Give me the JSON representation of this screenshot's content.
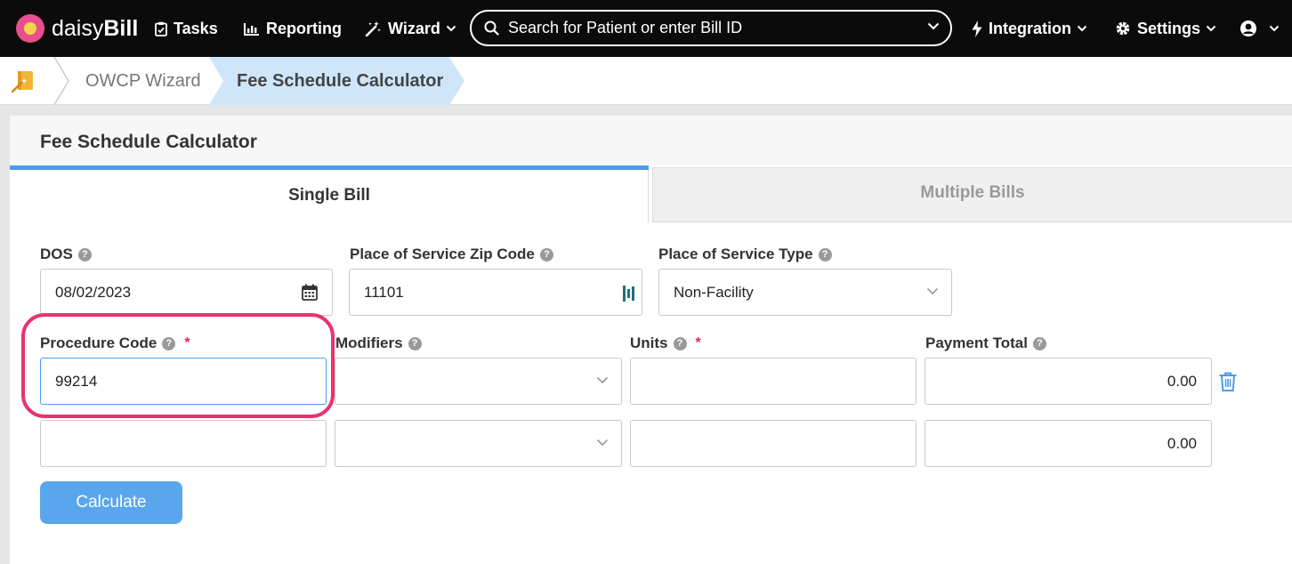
{
  "nav": {
    "brand_light": "daisy",
    "brand_bold": "Bill",
    "tasks": "Tasks",
    "reporting": "Reporting",
    "wizard": "Wizard",
    "search_placeholder": "Search for Patient or enter Bill ID",
    "integration": "Integration",
    "settings": "Settings"
  },
  "breadcrumb": {
    "items": [
      "OWCP Wizard",
      "Fee Schedule Calculator"
    ]
  },
  "panel": {
    "title": "Fee Schedule Calculator",
    "tabs": [
      {
        "label": "Single Bill",
        "active": true
      },
      {
        "label": "Multiple Bills",
        "active": false
      }
    ]
  },
  "form": {
    "dos_label": "DOS",
    "dos_value": "08/02/2023",
    "zip_label": "Place of Service Zip Code",
    "zip_value": "11101",
    "type_label": "Place of Service Type",
    "type_value": "Non-Facility",
    "procedure_label": "Procedure Code",
    "modifiers_label": "Modifiers",
    "units_label": "Units",
    "payment_label": "Payment Total",
    "required_mark": "*",
    "rows": [
      {
        "procedure": "99214",
        "modifiers": "",
        "units": "",
        "payment": "0.00"
      },
      {
        "procedure": "",
        "modifiers": "",
        "units": "",
        "payment": "0.00"
      }
    ],
    "calculate_label": "Calculate"
  },
  "colors": {
    "nav_bg": "#0b0b0b",
    "accent": "#4e9be8",
    "button": "#5aa6ec",
    "highlight": "#e8336f",
    "required": "#e0245e"
  }
}
